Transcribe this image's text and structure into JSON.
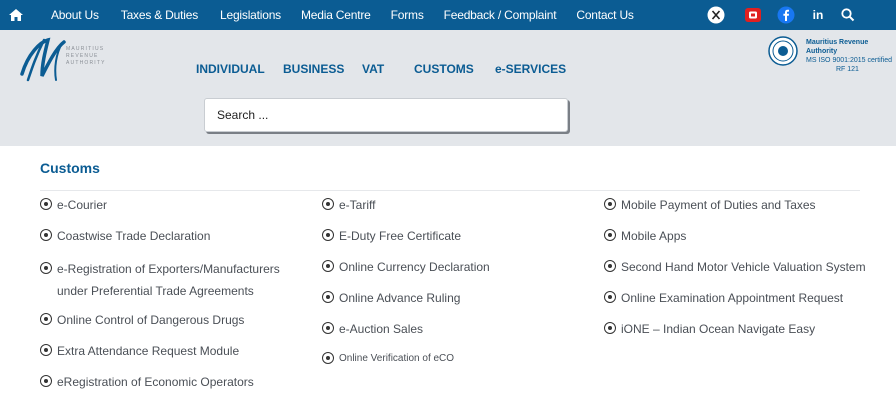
{
  "topbar": {
    "links": [
      "About Us",
      "Taxes & Duties",
      "Legislations",
      "Media Centre",
      "Forms",
      "Feedback / Complaint",
      "Contact Us"
    ],
    "social_in": "in"
  },
  "header": {
    "logo_lines": [
      "MAURITIUS",
      "REVENUE",
      "AUTHORITY"
    ],
    "nav": [
      "INDIVIDUAL",
      "BUSINESS",
      "VAT",
      "CUSTOMS",
      "e-SERVICES"
    ],
    "org_title": "Mauritius Revenue Authority",
    "iso": "MS ISO 9001:2015 certified",
    "rf": "RF 121"
  },
  "search": {
    "placeholder": "Search ..."
  },
  "customs": {
    "title": "Customs",
    "col1": [
      "e-Courier",
      "Coastwise Trade Declaration",
      "e-Registration of Exporters/Manufacturers under Preferential Trade Agreements",
      "Online Control of Dangerous Drugs",
      "Extra Attendance Request Module",
      "eRegistration of Economic Operators"
    ],
    "col2": [
      "e-Tariff",
      "E-Duty Free Certificate",
      "Online Currency Declaration",
      "Online Advance Ruling",
      "e-Auction Sales",
      "Online Verification of eCO"
    ],
    "col3": [
      "Mobile Payment of Duties and Taxes",
      "Mobile Apps",
      "Second Hand Motor Vehicle Valuation System",
      "Online Examination Appointment Request",
      "iONE – Indian Ocean Navigate Easy"
    ]
  },
  "colors": {
    "brand": "#0b5c93",
    "header_bg": "#e3e6ea",
    "text": "#4a4f56"
  }
}
